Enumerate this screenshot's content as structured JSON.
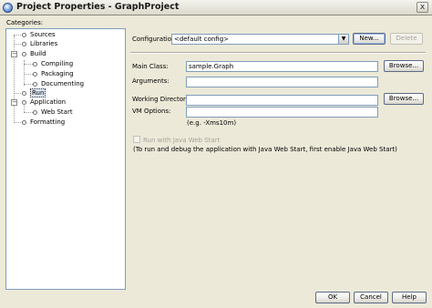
{
  "window": {
    "title": "Project Properties - GraphProject",
    "close_label": "x"
  },
  "categories": {
    "label": "Categories:",
    "tree": {
      "sources": "Sources",
      "libraries": "Libraries",
      "build": "Build",
      "compiling": "Compiling",
      "packaging": "Packaging",
      "documenting": "Documenting",
      "run": "Run",
      "application": "Application",
      "web_start": "Web Start",
      "formatting": "Formatting"
    },
    "selected": "Run",
    "expand_symbol": "−"
  },
  "config": {
    "label": "Configuration:",
    "value": "<default config>",
    "arrow": "▼",
    "new_button": "New...",
    "delete_button": "Delete"
  },
  "form": {
    "main_class_label": "Main Class:",
    "main_class_value": "sample.Graph",
    "main_class_browse": "Browse...",
    "arguments_label": "Arguments:",
    "arguments_value": "",
    "working_dir_label": "Working Directory:",
    "working_dir_value": "",
    "working_dir_browse": "Browse...",
    "vm_options_label": "VM Options:",
    "vm_options_value": "",
    "vm_options_hint": "(e.g. -Xms10m)",
    "web_start_checkbox_label": "Run with Java Web Start",
    "web_start_note": "(To run and debug the application with Java Web Start, first enable Java Web Start)"
  },
  "footer": {
    "ok": "OK",
    "cancel": "Cancel",
    "help": "Help"
  }
}
